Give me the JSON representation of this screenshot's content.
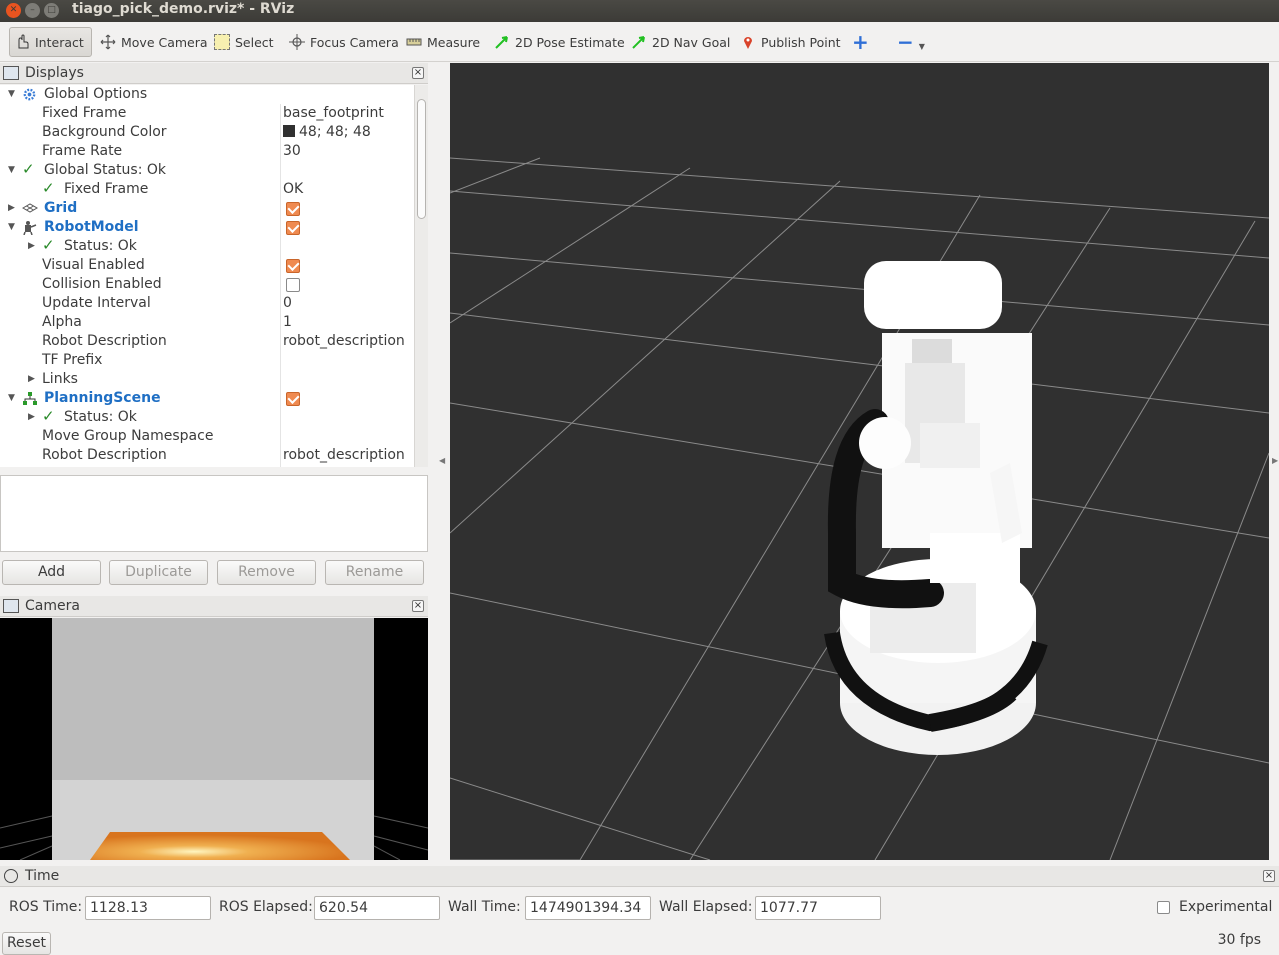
{
  "window": {
    "title": "tiago_pick_demo.rviz* - RViz",
    "close_glyph": "✕",
    "min_glyph": "–",
    "max_glyph": "□"
  },
  "toolbar": {
    "interact": "Interact",
    "move_camera": "Move Camera",
    "select": "Select",
    "focus_camera": "Focus Camera",
    "measure": "Measure",
    "pose_estimate": "2D Pose Estimate",
    "nav_goal": "2D Nav Goal",
    "publish_point": "Publish Point",
    "add_tool": "+",
    "remove_tool": "−"
  },
  "displays_panel": {
    "title": "Displays",
    "close": "×",
    "rows": [
      {
        "label": "Global Options"
      },
      {
        "label": "Fixed Frame",
        "value": "base_footprint"
      },
      {
        "label": "Background Color",
        "value": "48; 48; 48"
      },
      {
        "label": "Frame Rate",
        "value": "30"
      },
      {
        "label": "Global Status: Ok"
      },
      {
        "label": "Fixed Frame",
        "value": "OK"
      },
      {
        "label": "Grid",
        "checked": true
      },
      {
        "label": "RobotModel",
        "checked": true
      },
      {
        "label": "Status: Ok"
      },
      {
        "label": "Visual Enabled",
        "checked": true
      },
      {
        "label": "Collision Enabled",
        "checked": false
      },
      {
        "label": "Update Interval",
        "value": "0"
      },
      {
        "label": "Alpha",
        "value": "1"
      },
      {
        "label": "Robot Description",
        "value": "robot_description"
      },
      {
        "label": "TF Prefix"
      },
      {
        "label": "Links"
      },
      {
        "label": "PlanningScene",
        "checked": true
      },
      {
        "label": "Status: Ok"
      },
      {
        "label": "Move Group Namespace"
      },
      {
        "label": "Robot Description",
        "value": "robot_description"
      }
    ],
    "buttons": {
      "add": "Add",
      "duplicate": "Duplicate",
      "remove": "Remove",
      "rename": "Rename"
    }
  },
  "camera_panel": {
    "title": "Camera",
    "close": "×"
  },
  "time_panel": {
    "title": "Time",
    "close": "×",
    "ros_time_label": "ROS Time:",
    "ros_time": "1128.13",
    "ros_elapsed_label": "ROS Elapsed:",
    "ros_elapsed": "620.54",
    "wall_time_label": "Wall Time:",
    "wall_time": "1474901394.34",
    "wall_elapsed_label": "Wall Elapsed:",
    "wall_elapsed": "1077.77",
    "experimental_label": "Experimental",
    "experimental_checked": false
  },
  "statusbar": {
    "reset": "Reset",
    "fps": "30 fps"
  },
  "colors": {
    "background": "#303030",
    "accent": "#ef8a50",
    "link_blue": "#1f6fc4",
    "grid_line": "#a0a0a0"
  }
}
